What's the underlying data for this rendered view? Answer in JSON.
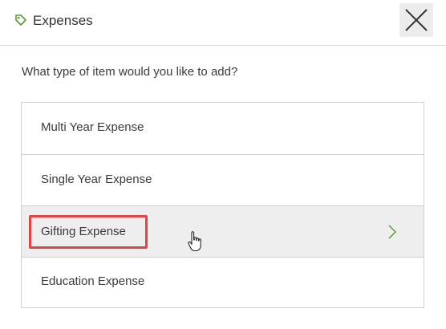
{
  "header": {
    "title": "Expenses",
    "icon": "tag-icon",
    "close_icon": "close-icon"
  },
  "prompt": "What type of item would you like to add?",
  "options": [
    {
      "label": "Multi Year Expense"
    },
    {
      "label": "Single Year Expense"
    },
    {
      "label": "Gifting Expense",
      "hovered": true,
      "highlighted": true
    },
    {
      "label": "Education Expense"
    }
  ],
  "colors": {
    "accent_green": "#5a9a3a",
    "highlight_red": "#e04444",
    "hover_background": "#eeeeee"
  }
}
